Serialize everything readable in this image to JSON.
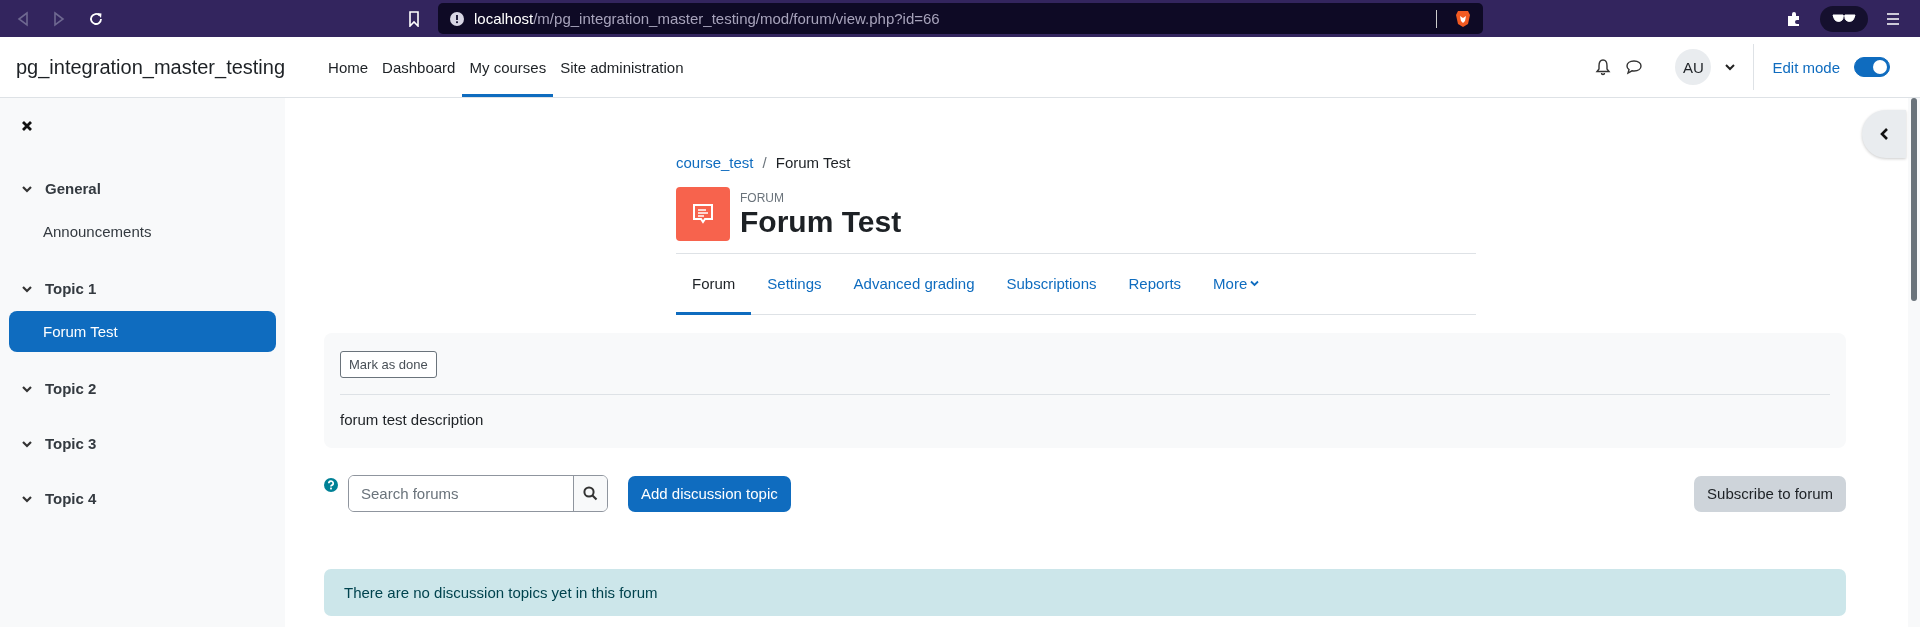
{
  "browser": {
    "url_host": "localhost",
    "url_path": "/m/pg_integration_master_testing/mod/forum/view.php?id=66"
  },
  "navbar": {
    "site_name": "pg_integration_master_testing",
    "items": [
      {
        "label": "Home",
        "selected": false
      },
      {
        "label": "Dashboard",
        "selected": false
      },
      {
        "label": "My courses",
        "selected": true
      },
      {
        "label": "Site administration",
        "selected": false
      }
    ],
    "user_initials": "AU",
    "edit_mode": {
      "label": "Edit mode",
      "on": true
    }
  },
  "sidebar": {
    "sections": [
      {
        "title": "General",
        "expanded": true,
        "items": [
          {
            "label": "Announcements",
            "selected": false
          }
        ]
      },
      {
        "title": "Topic 1",
        "expanded": true,
        "items": [
          {
            "label": "Forum Test",
            "selected": true
          }
        ]
      },
      {
        "title": "Topic 2",
        "expanded": true
      },
      {
        "title": "Topic 3",
        "expanded": true
      },
      {
        "title": "Topic 4",
        "expanded": true
      }
    ]
  },
  "breadcrumb": {
    "separator": "/",
    "items": [
      {
        "label": "course_test",
        "kind": "link"
      },
      {
        "label": "Forum Test",
        "kind": "current"
      }
    ]
  },
  "activity": {
    "type_label": "FORUM",
    "title": "Forum Test"
  },
  "tabs": [
    {
      "label": "Forum",
      "selected": true,
      "kind": "link"
    },
    {
      "label": "Settings",
      "selected": false,
      "kind": "link"
    },
    {
      "label": "Advanced grading",
      "selected": false,
      "kind": "link"
    },
    {
      "label": "Subscriptions",
      "selected": false,
      "kind": "link"
    },
    {
      "label": "Reports",
      "selected": false,
      "kind": "link"
    },
    {
      "label": "More",
      "selected": false,
      "kind": "dropdown"
    }
  ],
  "card": {
    "mark_done_button": "Mark as done",
    "description": "forum test description"
  },
  "search": {
    "placeholder": "Search forums"
  },
  "add_button": "Add discussion topic",
  "subscribe_button": "Subscribe to forum",
  "alert": "There are no discussion topics yet in this forum"
}
